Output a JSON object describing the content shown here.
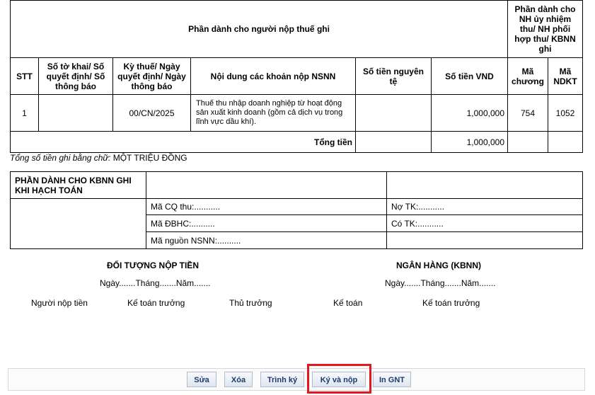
{
  "table": {
    "taxpayer_section_title": "Phần dành cho người nộp thuế ghi",
    "bank_section_title": "Phần dành cho NH ủy nhiệm thu/ NH phối hợp thu/ KBNN ghi",
    "headers": {
      "stt": "STT",
      "so_to_khai": "Số tờ khai/ Số quyết định/ Số thông báo",
      "ky_thue": "Kỳ thuế/ Ngày quyết định/ Ngày thông báo",
      "noi_dung": "Nội dung các khoản nộp NSNN",
      "so_tien_nguyen_te": "Số tiền nguyên tệ",
      "so_tien_vnd": "Số tiền VND",
      "ma_chuong": "Mã chương",
      "ma_ndkt": "Mã NDKT"
    },
    "rows": [
      {
        "stt": "1",
        "so_to_khai": "",
        "ky_thue": "00/CN/2025",
        "noi_dung": "Thuế thu nhập doanh nghiệp từ hoạt động sản xuất kinh doanh (gồm cả dịch vụ trong lĩnh vực dầu khí).",
        "so_tien_nguyen_te": "",
        "so_tien_vnd": "1,000,000",
        "ma_chuong": "754",
        "ma_ndkt": "1052"
      }
    ],
    "total_label": "Tổng tiền",
    "total_vnd": "1,000,000"
  },
  "amount_in_words": {
    "label": "Tổng số tiền ghi bằng chữ:",
    "value": "MỘT TRIỆU ĐỒNG"
  },
  "kbnn": {
    "title": "PHẦN DÀNH CHO KBNN GHI KHI HẠCH TOÁN",
    "ma_cq_thu": "Mã CQ thu:...........",
    "ma_dbhc": "Mã ĐBHC:..........",
    "ma_nguon": "Mã nguồn NSNN:..........",
    "no_tk": "Nợ TK:...........",
    "co_tk": "Có TK:..........."
  },
  "signatures": {
    "payer_title": "ĐỐI TƯỢNG NỘP TIỀN",
    "bank_title": "NGÂN HÀNG (KBNN)",
    "payer_date": "Ngày.......Tháng.......Năm.......",
    "bank_date": "Ngày.......Tháng.......Năm.......",
    "payer_person": "Người nộp tiền",
    "payer_chief_accountant": "Kế toán trưởng",
    "bank_director": "Thủ trưởng",
    "bank_accountant": "Kế toán",
    "bank_chief_accountant": "Kế toán trưởng"
  },
  "toolbar": {
    "edit": "Sửa",
    "delete": "Xóa",
    "submit": "Trình ký",
    "sign_and_pay": "Ký và nộp",
    "print": "In GNT"
  },
  "colors": {
    "highlight": "#e0191f",
    "button_text": "#1f3a6b"
  }
}
